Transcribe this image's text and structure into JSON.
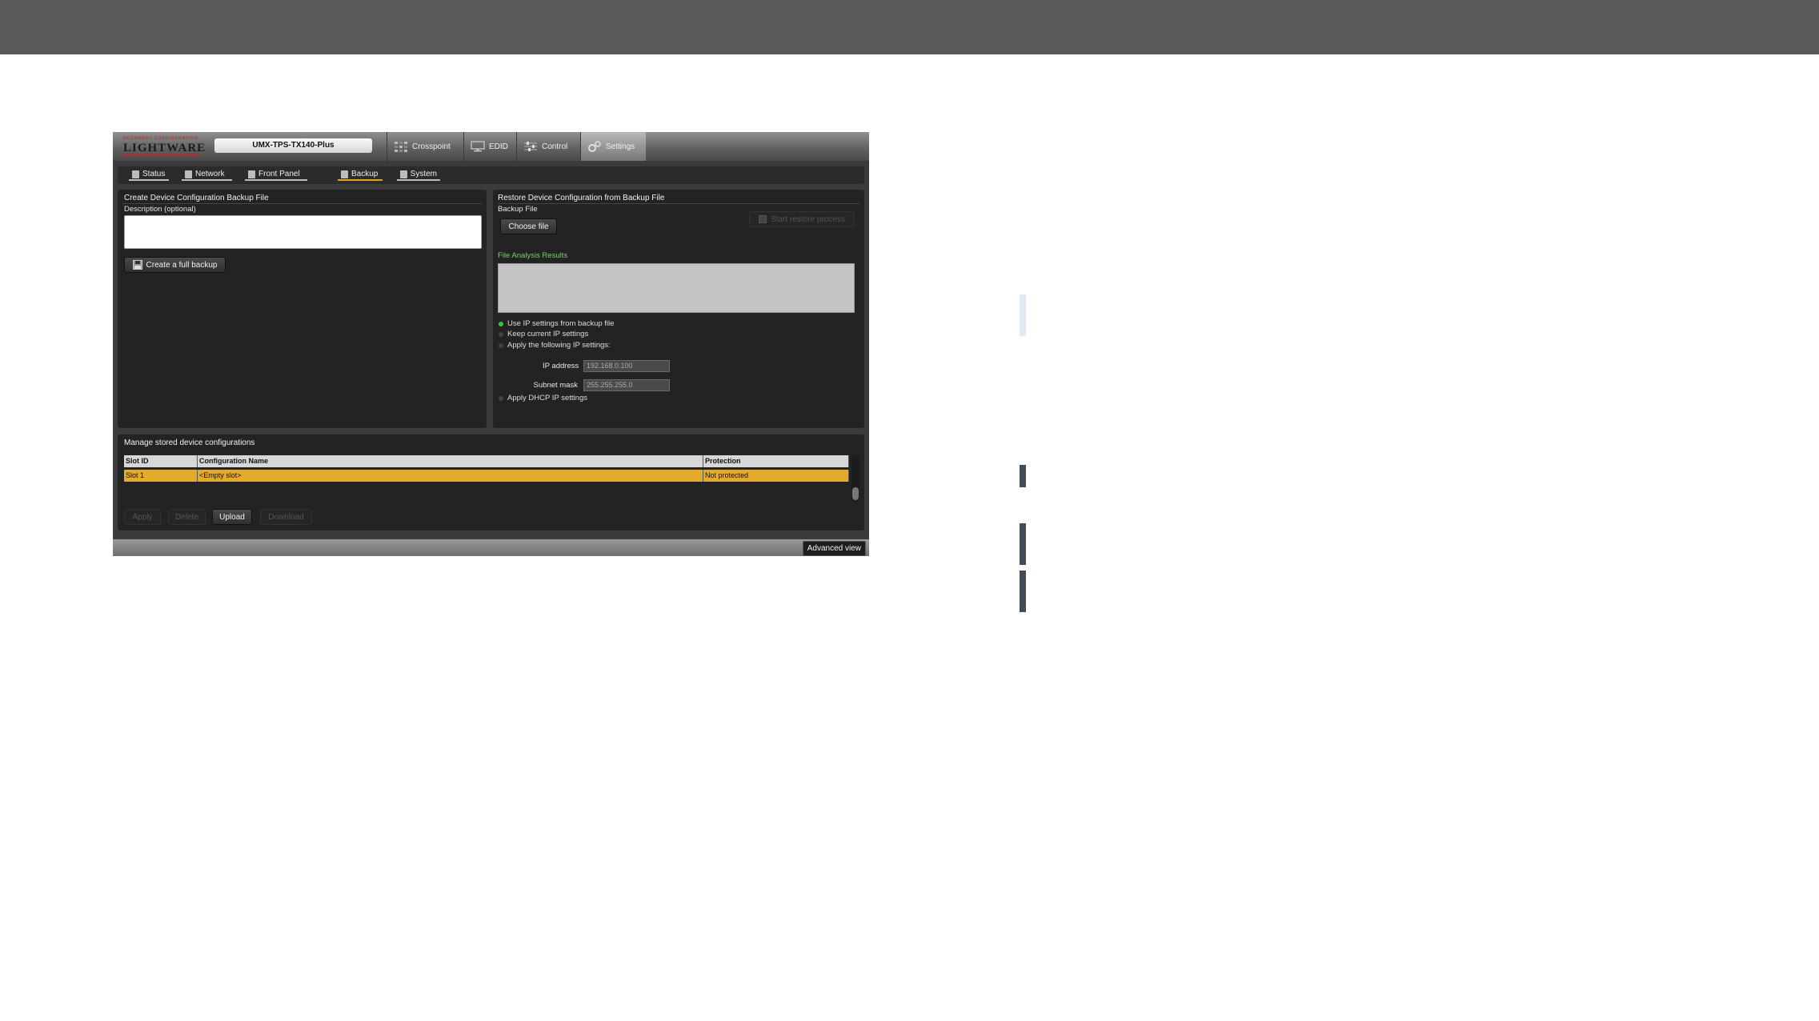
{
  "app": {
    "logo_small": "DOCUMENT CONFIGURATION",
    "logo_text": "LIGHTWARE",
    "device_name": "UMX-TPS-TX140-Plus",
    "top_tabs": [
      {
        "label": "Crosspoint",
        "icon": "crosspoint-icon"
      },
      {
        "label": "EDID",
        "icon": "monitor-icon"
      },
      {
        "label": "Control",
        "icon": "sliders-icon"
      },
      {
        "label": "Settings",
        "icon": "gear-icon",
        "active": true
      }
    ],
    "sub_tabs": [
      {
        "label": "Status"
      },
      {
        "label": "Network"
      },
      {
        "label": "Front Panel"
      },
      {
        "label": "Backup",
        "active": true
      },
      {
        "label": "System"
      }
    ]
  },
  "create_panel": {
    "title": "Create Device Configuration Backup File",
    "description_label": "Description (optional)",
    "description_value": "",
    "create_button": "Create a full backup"
  },
  "restore_panel": {
    "title": "Restore Device Configuration from Backup File",
    "backup_file_label": "Backup File",
    "choose_file_button": "Choose file",
    "start_button": "Start restore process",
    "analysis_label": "File Analysis Results",
    "analysis_value": "",
    "options": [
      {
        "label": "Use IP settings from backup file",
        "selected": true
      },
      {
        "label": "Keep current IP settings",
        "selected": false
      },
      {
        "label": "Apply the following IP settings:",
        "selected": false
      },
      {
        "label": "Apply DHCP IP settings",
        "selected": false
      }
    ],
    "ip_label": "IP address",
    "ip_value": "192.168.0.100",
    "mask_label": "Subnet mask",
    "mask_value": "255.255.255.0"
  },
  "manage_panel": {
    "title": "Manage stored device configurations",
    "columns": [
      "Slot ID",
      "Configuration Name",
      "Protection"
    ],
    "rows": [
      [
        "Slot 1",
        "<Empty slot>",
        "Not protected"
      ]
    ],
    "buttons": [
      {
        "label": "Apply",
        "enabled": false
      },
      {
        "label": "Delete",
        "enabled": false
      },
      {
        "label": "Upload",
        "enabled": true
      },
      {
        "label": "Download",
        "enabled": false
      }
    ]
  },
  "footer": {
    "advanced_view_button": "Advanced view"
  },
  "colors": {
    "accent": "#e3aa2b",
    "selected_green": "#3cc43c",
    "brand_red": "#c0262b"
  }
}
